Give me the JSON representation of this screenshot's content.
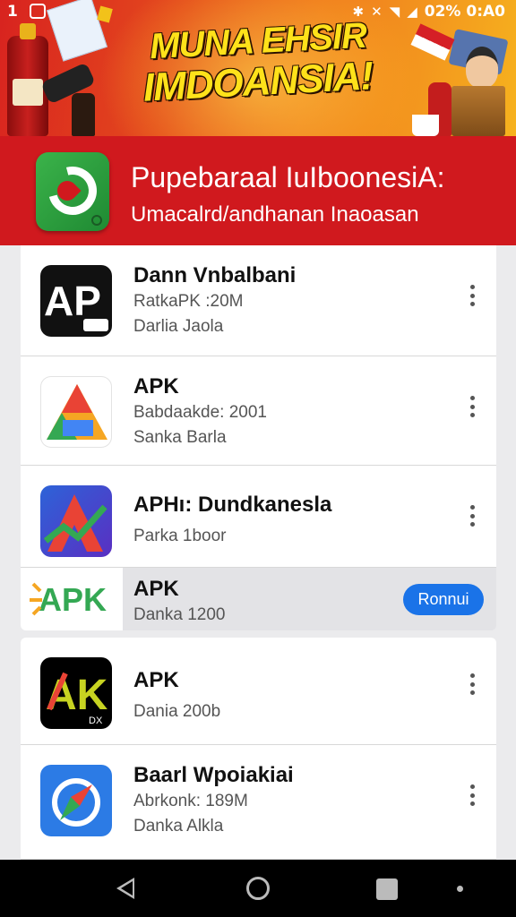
{
  "status_bar": {
    "time": "1",
    "right_text": "02% 0:A0",
    "icons": [
      "notification-icon",
      "bluetooth-icon",
      "mute-icon",
      "wifi-icon",
      "signal-icon",
      "battery-icon"
    ]
  },
  "banner": {
    "line1": "MUNA EHSIR",
    "line2": "IMDOANSIA!"
  },
  "header": {
    "title": "Pupebaraal IuIboonesiA:",
    "subtitle": "Umacalrd/andhanan Inaoasan",
    "accent_color": "#d0191e"
  },
  "apps": [
    {
      "name": "Dann Vnbalbani",
      "meta1": "RatkaPK :20M",
      "meta2": "Darlia Jaola",
      "icon": "ap-logo-icon"
    },
    {
      "name": "APK",
      "meta1": "Babdaakde: 2001",
      "meta2": "Sanka Barla",
      "icon": "colorful-a-icon"
    },
    {
      "name": "APHı: Dundkanesla",
      "meta1": "Parka 1boor",
      "meta2": "",
      "icon": "a-chart-icon"
    },
    {
      "name": "APK",
      "meta1": "Danka 1200",
      "meta2": "",
      "icon": "apk-text-icon",
      "button": "Ronnui"
    },
    {
      "name": "APK",
      "meta1": "Dania 200b",
      "meta2": "",
      "icon": "ak-logo-icon"
    },
    {
      "name": "Baarl Wpoiakiai",
      "meta1": "Abrkonk: 189M",
      "meta2": "Danka Alkla",
      "icon": "compass-icon"
    }
  ],
  "navbar": {
    "icons": [
      "back-icon",
      "home-icon",
      "recents-icon",
      "dot-icon"
    ]
  }
}
